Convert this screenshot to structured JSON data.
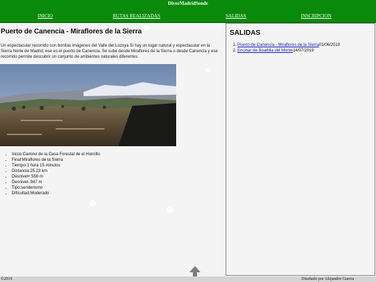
{
  "header": {
    "site_title": "DiverMadridSende"
  },
  "nav": [
    {
      "label": "INICIO"
    },
    {
      "label": "RUTAS REALIZADAS"
    },
    {
      "label": "SALIDAS"
    },
    {
      "label": "INSCRIPCION"
    }
  ],
  "route": {
    "title": "Puerto de Canencia - Miraflores de la Sierra",
    "description": "Un espectacular recorrido con bonitas imágenes del Valle del Lozoya Si hay un lugar natural y espectacular en la Sierra Norte de Madrid, ese es el puerto de Canencia. Se sube desde Miraflores de la Sierra o desde Canencia y ese recorrido permite descubrir un conjunto de ambientes naturales diferentes.",
    "details": [
      "Inicio:Camino de la Casa Forestal de el Hornillo",
      "Final:Miraflores de la Sierra",
      "Tiempo:1 hora 15 minutos",
      "Distancia:25.23 km",
      "Desnivel+:556 m",
      "Desnivel-:947 m",
      "Tipo:senderismo",
      "Dificultad:Moderado"
    ]
  },
  "sidebar": {
    "title": "SALIDAS",
    "items": [
      {
        "link": "Puerto de Canencia - Miraflores de la Sierra",
        "date": "01/06/2019"
      },
      {
        "link": "Encinar de Boadilla del Monte",
        "date": "14/07/2019"
      }
    ]
  },
  "footer": {
    "copyright": "©2019",
    "credit": "Diseñado por Alejandro Guerra"
  },
  "colors": {
    "header_green": "#0a8a0a",
    "background": "#f4f4f4",
    "link_blue": "#1a1ab5"
  }
}
